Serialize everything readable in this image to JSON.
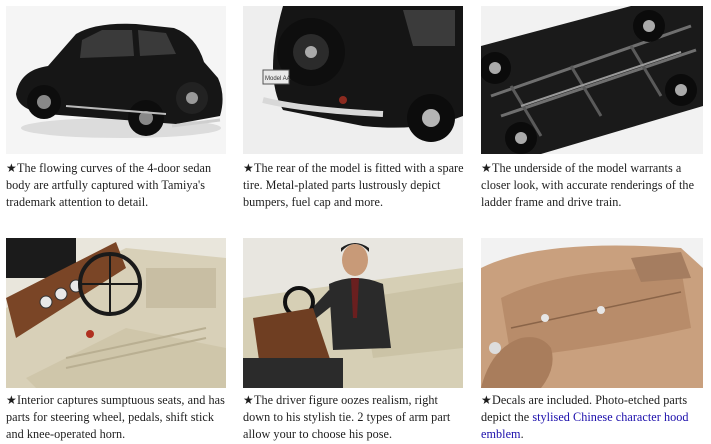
{
  "captions": [
    {
      "text": "★The flowing curves of the 4-door sedan body are artfully captured with Tamiya's trademark attention to detail."
    },
    {
      "text": "★The rear of the model is fitted with a spare tire. Metal-plated parts lustrously depict bumpers, fuel cap and more."
    },
    {
      "text": "★The underside of the model warrants a closer look, with accurate renderings of the ladder frame and drive train."
    },
    {
      "text": "★Interior captures sumptuous seats, and has parts for steering wheel, pedals, shift stick and knee-operated horn."
    },
    {
      "text": "★The driver figure oozes realism, right down to his stylish tie. 2 types of arm part allow your to choose his pose."
    },
    {
      "text_before": "★Decals are included. Photo-etched parts depict the ",
      "link": "stylised Chinese character hood emblem",
      "text_after": "."
    }
  ],
  "photos": [
    {
      "icon": "car-side-photo"
    },
    {
      "icon": "car-rear-photo",
      "plate_text": "Model AA"
    },
    {
      "icon": "car-underside-photo"
    },
    {
      "icon": "interior-dashboard-photo"
    },
    {
      "icon": "driver-figure-photo"
    },
    {
      "icon": "hood-emblem-photo"
    }
  ],
  "colors": {
    "car_black": "#141414",
    "car_tan": "#c9a07e",
    "interior_beige": "#d9d1b9",
    "link": "#1a0dab"
  }
}
